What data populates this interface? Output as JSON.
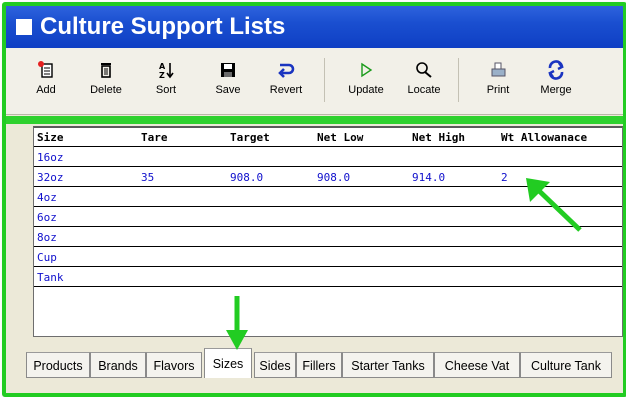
{
  "window": {
    "title": "Culture Support Lists"
  },
  "toolbar": {
    "buttons": [
      {
        "label": "Add",
        "icon": "add-record-icon"
      },
      {
        "label": "Delete",
        "icon": "trash-icon"
      },
      {
        "label": "Sort",
        "icon": "sort-az-icon"
      },
      {
        "label": "Save",
        "icon": "floppy-disk-icon"
      },
      {
        "label": "Revert",
        "icon": "revert-icon"
      },
      {
        "label": "Update",
        "icon": "play-icon"
      },
      {
        "label": "Locate",
        "icon": "binoculars-icon"
      },
      {
        "label": "Print",
        "icon": "printer-icon"
      },
      {
        "label": "Merge",
        "icon": "merge-arrows-icon"
      }
    ]
  },
  "table": {
    "headers": [
      "Size",
      "Tare",
      "Target",
      "Net Low",
      "Net High",
      "Wt Allowanace"
    ],
    "rows": [
      [
        "16oz",
        "",
        "",
        "",
        "",
        ""
      ],
      [
        "32oz",
        "35",
        "908.0",
        "908.0",
        "914.0",
        "2"
      ],
      [
        "4oz",
        "",
        "",
        "",
        "",
        ""
      ],
      [
        "6oz",
        "",
        "",
        "",
        "",
        ""
      ],
      [
        "8oz",
        "",
        "",
        "",
        "",
        ""
      ],
      [
        "Cup",
        "",
        "",
        "",
        "",
        ""
      ],
      [
        "Tank",
        "",
        "",
        "",
        "",
        ""
      ]
    ]
  },
  "tabs": {
    "items": [
      "Products",
      "Brands",
      "Flavors",
      "Sizes",
      "Sides",
      "Fillers",
      "Starter Tanks",
      "Cheese Vat",
      "Culture Tank"
    ],
    "active": "Sizes"
  },
  "colors": {
    "accent": "#22cc22",
    "titlebar": "#1a4fd0",
    "cell_text": "#1010cc"
  }
}
